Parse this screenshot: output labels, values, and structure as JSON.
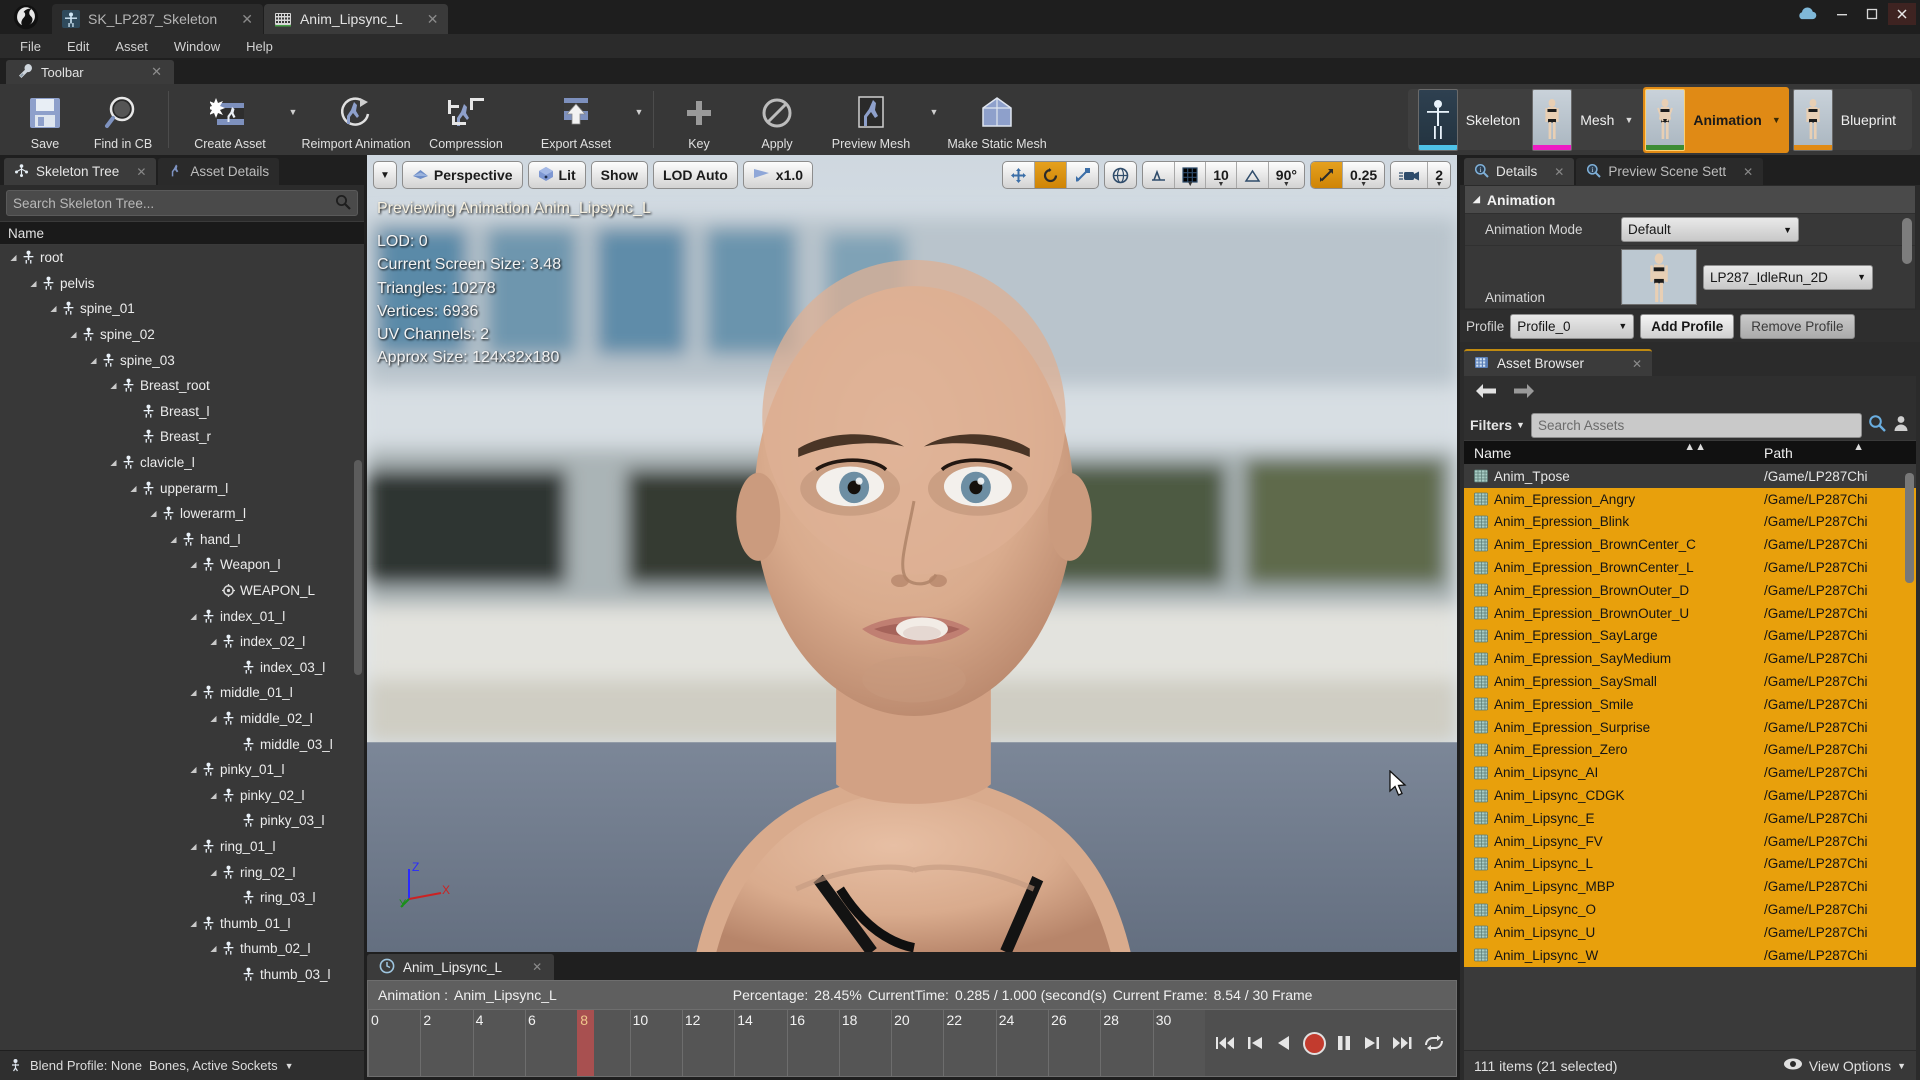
{
  "window": {
    "tabs": [
      {
        "label": "SK_LP287_Skeleton",
        "icon": "skeleton-icon",
        "active": false
      },
      {
        "label": "Anim_Lipsync_L",
        "icon": "animation-icon",
        "active": true
      }
    ],
    "controls": {
      "minimize": "minimize-icon",
      "maximize": "maximize-icon",
      "close": "close-icon",
      "cloud": "cloud-icon"
    }
  },
  "menu": {
    "items": [
      "File",
      "Edit",
      "Asset",
      "Window",
      "Help"
    ]
  },
  "toolbar": {
    "tab_label": "Toolbar",
    "buttons": [
      {
        "label": "Save",
        "icon": "save-icon",
        "caret": false
      },
      {
        "label": "Find in CB",
        "icon": "magnifier-icon",
        "caret": false
      },
      {
        "label": "Create Asset",
        "icon": "create-asset-icon",
        "caret": true
      },
      {
        "label": "Reimport Animation",
        "icon": "reimport-icon",
        "caret": false
      },
      {
        "label": "Compression",
        "icon": "compression-icon",
        "caret": false
      },
      {
        "label": "Export Asset",
        "icon": "export-icon",
        "caret": true
      },
      {
        "label": "Key",
        "icon": "plus-icon",
        "caret": false
      },
      {
        "label": "Apply",
        "icon": "apply-icon",
        "caret": false
      },
      {
        "label": "Preview Mesh",
        "icon": "preview-mesh-icon",
        "caret": true
      },
      {
        "label": "Make Static Mesh",
        "icon": "static-mesh-icon",
        "caret": false
      }
    ],
    "modes": [
      {
        "label": "Skeleton",
        "active": false,
        "caret": false,
        "bar_color": "#4ec3e8"
      },
      {
        "label": "Mesh",
        "active": false,
        "caret": true,
        "bar_color": "#ee1bc4"
      },
      {
        "label": "Animation",
        "active": true,
        "caret": true,
        "bar_color": "#3d8c34"
      },
      {
        "label": "Blueprint",
        "active": false,
        "caret": false,
        "bar_color": "#e08a15"
      }
    ]
  },
  "left_panel": {
    "tabs": [
      {
        "label": "Skeleton Tree",
        "icon": "skeleton-tree-icon",
        "active": true
      },
      {
        "label": "Asset Details",
        "icon": "asset-details-icon",
        "active": false
      }
    ],
    "search_placeholder": "Search Skeleton Tree...",
    "column_header": "Name",
    "footer_label": "Blend Profile: None",
    "footer_label2": "Bones, Active Sockets",
    "tree": [
      {
        "name": "root",
        "depth": 0,
        "expandable": true
      },
      {
        "name": "pelvis",
        "depth": 1,
        "expandable": true
      },
      {
        "name": "spine_01",
        "depth": 2,
        "expandable": true
      },
      {
        "name": "spine_02",
        "depth": 3,
        "expandable": true
      },
      {
        "name": "spine_03",
        "depth": 4,
        "expandable": true
      },
      {
        "name": "Breast_root",
        "depth": 5,
        "expandable": true
      },
      {
        "name": "Breast_l",
        "depth": 6,
        "expandable": false
      },
      {
        "name": "Breast_r",
        "depth": 6,
        "expandable": false
      },
      {
        "name": "clavicle_l",
        "depth": 5,
        "expandable": true
      },
      {
        "name": "upperarm_l",
        "depth": 6,
        "expandable": true
      },
      {
        "name": "lowerarm_l",
        "depth": 7,
        "expandable": true
      },
      {
        "name": "hand_l",
        "depth": 8,
        "expandable": true
      },
      {
        "name": "Weapon_l",
        "depth": 9,
        "expandable": true
      },
      {
        "name": "WEAPON_L",
        "depth": 10,
        "expandable": false,
        "socket": true
      },
      {
        "name": "index_01_l",
        "depth": 9,
        "expandable": true
      },
      {
        "name": "index_02_l",
        "depth": 10,
        "expandable": true
      },
      {
        "name": "index_03_l",
        "depth": 11,
        "expandable": false
      },
      {
        "name": "middle_01_l",
        "depth": 9,
        "expandable": true
      },
      {
        "name": "middle_02_l",
        "depth": 10,
        "expandable": true
      },
      {
        "name": "middle_03_l",
        "depth": 11,
        "expandable": false
      },
      {
        "name": "pinky_01_l",
        "depth": 9,
        "expandable": true
      },
      {
        "name": "pinky_02_l",
        "depth": 10,
        "expandable": true
      },
      {
        "name": "pinky_03_l",
        "depth": 11,
        "expandable": false
      },
      {
        "name": "ring_01_l",
        "depth": 9,
        "expandable": true
      },
      {
        "name": "ring_02_l",
        "depth": 10,
        "expandable": true
      },
      {
        "name": "ring_03_l",
        "depth": 11,
        "expandable": false
      },
      {
        "name": "thumb_01_l",
        "depth": 9,
        "expandable": true
      },
      {
        "name": "thumb_02_l",
        "depth": 10,
        "expandable": true
      },
      {
        "name": "thumb_03_l",
        "depth": 11,
        "expandable": false
      }
    ]
  },
  "viewport": {
    "view_caret": "chevron-down-icon",
    "buttons": [
      {
        "label": "Perspective",
        "icon": "perspective-icon"
      },
      {
        "label": "Lit",
        "icon": "lit-cube-icon"
      },
      {
        "label": "Show",
        "icon": ""
      },
      {
        "label": "LOD Auto",
        "icon": ""
      },
      {
        "label": "x1.0",
        "icon": "playrate-icon"
      }
    ],
    "right_groups": [
      {
        "items": [
          {
            "label": "",
            "icon": "move-icon",
            "active": false
          },
          {
            "label": "",
            "icon": "rotate-icon",
            "active": true
          },
          {
            "label": "",
            "icon": "scale-icon",
            "active": false
          }
        ]
      },
      {
        "items": [
          {
            "label": "",
            "icon": "globe-icon",
            "active": false
          }
        ]
      },
      {
        "items": [
          {
            "label": "",
            "icon": "grid-snap-icon",
            "active": false
          },
          {
            "label": "",
            "icon": "grid-icon",
            "active": false
          },
          {
            "label": "10",
            "icon": "",
            "active": false
          },
          {
            "label": "",
            "icon": "angle-snap-icon",
            "active": false
          },
          {
            "label": "90°",
            "icon": "",
            "active": false
          }
        ]
      },
      {
        "items": [
          {
            "label": "",
            "icon": "scale-snap-icon",
            "active": true
          },
          {
            "label": "0.25",
            "icon": "",
            "active": false
          }
        ]
      },
      {
        "items": [
          {
            "label": "2",
            "icon": "camera-speed-icon",
            "active": false
          }
        ]
      }
    ],
    "overlay_title": "Previewing Animation Anim_Lipsync_L",
    "stats": [
      "LOD: 0",
      "Current Screen Size: 3.48",
      "Triangles: 10278",
      "Vertices: 6936",
      "UV Channels: 2",
      "Approx Size: 124x32x180"
    ],
    "axis": {
      "x": "X",
      "y": "Y",
      "z": "Z"
    }
  },
  "timeline": {
    "tab_label": "Anim_Lipsync_L",
    "tab_icon": "clock-icon",
    "info": {
      "animation_label": "Animation :",
      "animation_name": "Anim_Lipsync_L",
      "percentage_label": "Percentage:",
      "percentage_value": "28.45%",
      "currenttime_label": "CurrentTime:",
      "currenttime_value": "0.285 / 1.000 (second(s)",
      "currentframe_label": "Current Frame:",
      "currentframe_value": "8.54 / 30 Frame"
    },
    "ticks": [
      "0",
      "2",
      "4",
      "6",
      "8",
      "10",
      "12",
      "14",
      "16",
      "18",
      "20",
      "22",
      "24",
      "26",
      "28",
      "30"
    ],
    "playhead_tick": "8",
    "transport": [
      "step-to-start",
      "step-back",
      "play-back",
      "record",
      "pause",
      "play-forward",
      "step-forward",
      "loop"
    ]
  },
  "right_panel": {
    "tabs": [
      {
        "label": "Details",
        "icon": "details-icon",
        "active": true
      },
      {
        "label": "Preview Scene Sett",
        "icon": "details-icon",
        "active": false
      }
    ],
    "category": "Animation",
    "properties": [
      {
        "label": "Animation Mode",
        "value": "Default",
        "type": "combo"
      },
      {
        "label": "Animation",
        "value": "LP287_IdleRun_2D",
        "type": "asset-combo"
      }
    ],
    "profile_row": {
      "label": "Profile",
      "value": "Profile_0",
      "add_label": "Add Profile",
      "remove_label": "Remove Profile"
    },
    "asset_browser": {
      "tab_label": "Asset Browser",
      "tab_icon": "asset-browser-icon",
      "nav": {
        "back": "back-arrow-icon",
        "forward": "forward-arrow-icon"
      },
      "filters_label": "Filters",
      "search_placeholder": "Search Assets",
      "user_icon": "user-icon",
      "search_icon": "search-icon",
      "columns": [
        "Name",
        "Path"
      ],
      "items": [
        {
          "name": "Anim_Tpose",
          "path": "/Game/LP287Chi",
          "selected": false
        },
        {
          "name": "Anim_Epression_Angry",
          "path": "/Game/LP287Chi",
          "selected": true
        },
        {
          "name": "Anim_Epression_Blink",
          "path": "/Game/LP287Chi",
          "selected": true
        },
        {
          "name": "Anim_Epression_BrownCenter_C",
          "path": "/Game/LP287Chi",
          "selected": true
        },
        {
          "name": "Anim_Epression_BrownCenter_L",
          "path": "/Game/LP287Chi",
          "selected": true
        },
        {
          "name": "Anim_Epression_BrownOuter_D",
          "path": "/Game/LP287Chi",
          "selected": true
        },
        {
          "name": "Anim_Epression_BrownOuter_U",
          "path": "/Game/LP287Chi",
          "selected": true
        },
        {
          "name": "Anim_Epression_SayLarge",
          "path": "/Game/LP287Chi",
          "selected": true
        },
        {
          "name": "Anim_Epression_SayMedium",
          "path": "/Game/LP287Chi",
          "selected": true
        },
        {
          "name": "Anim_Epression_SaySmall",
          "path": "/Game/LP287Chi",
          "selected": true
        },
        {
          "name": "Anim_Epression_Smile",
          "path": "/Game/LP287Chi",
          "selected": true
        },
        {
          "name": "Anim_Epression_Surprise",
          "path": "/Game/LP287Chi",
          "selected": true
        },
        {
          "name": "Anim_Epression_Zero",
          "path": "/Game/LP287Chi",
          "selected": true
        },
        {
          "name": "Anim_Lipsync_AI",
          "path": "/Game/LP287Chi",
          "selected": true
        },
        {
          "name": "Anim_Lipsync_CDGK",
          "path": "/Game/LP287Chi",
          "selected": true
        },
        {
          "name": "Anim_Lipsync_E",
          "path": "/Game/LP287Chi",
          "selected": true
        },
        {
          "name": "Anim_Lipsync_FV",
          "path": "/Game/LP287Chi",
          "selected": true
        },
        {
          "name": "Anim_Lipsync_L",
          "path": "/Game/LP287Chi",
          "selected": true
        },
        {
          "name": "Anim_Lipsync_MBP",
          "path": "/Game/LP287Chi",
          "selected": true
        },
        {
          "name": "Anim_Lipsync_O",
          "path": "/Game/LP287Chi",
          "selected": true
        },
        {
          "name": "Anim_Lipsync_U",
          "path": "/Game/LP287Chi",
          "selected": true
        },
        {
          "name": "Anim_Lipsync_W",
          "path": "/Game/LP287Chi",
          "selected": true
        }
      ],
      "footer": {
        "status": "111 items (21 selected)",
        "view_options": "View Options",
        "eye_icon": "eye-icon"
      }
    }
  },
  "colors": {
    "accent_orange": "#e8a00c",
    "panel_bg": "#2b2b2b",
    "tree_bg": "#383838",
    "selection": "#e8a00c"
  }
}
